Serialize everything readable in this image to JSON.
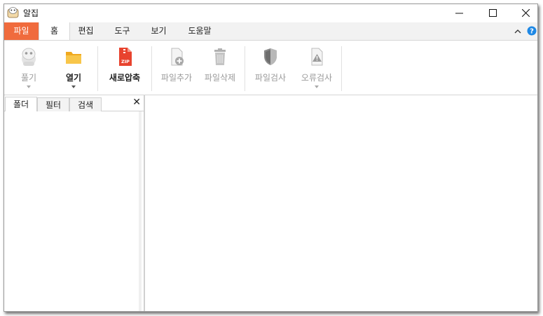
{
  "window": {
    "title": "알집"
  },
  "ribbon_tabs": [
    {
      "label": "파일"
    },
    {
      "label": "홈"
    },
    {
      "label": "편집"
    },
    {
      "label": "도구"
    },
    {
      "label": "보기"
    },
    {
      "label": "도움말"
    }
  ],
  "ribbon_buttons": {
    "unzip": {
      "label": "풀기",
      "icon": "unzip-mascot-icon",
      "disabled": true
    },
    "open": {
      "label": "열기",
      "icon": "folder-icon"
    },
    "new_zip": {
      "label": "새로압축",
      "icon": "zip-file-icon"
    },
    "add_file": {
      "label": "파일추가",
      "icon": "file-add-icon",
      "disabled": true
    },
    "delete_file": {
      "label": "파일삭제",
      "icon": "trash-icon",
      "disabled": true
    },
    "scan_file": {
      "label": "파일검사",
      "icon": "shield-icon",
      "disabled": true
    },
    "error_check": {
      "label": "오류검사",
      "icon": "warning-file-icon",
      "disabled": true
    }
  },
  "left_pane": {
    "tabs": [
      {
        "label": "폴더"
      },
      {
        "label": "필터"
      },
      {
        "label": "검색"
      }
    ],
    "close_glyph": "✕"
  },
  "colors": {
    "file_tab": "#f06b3d",
    "help": "#1e88e5",
    "folder": "#f5b82e",
    "zip": "#e8432e"
  }
}
